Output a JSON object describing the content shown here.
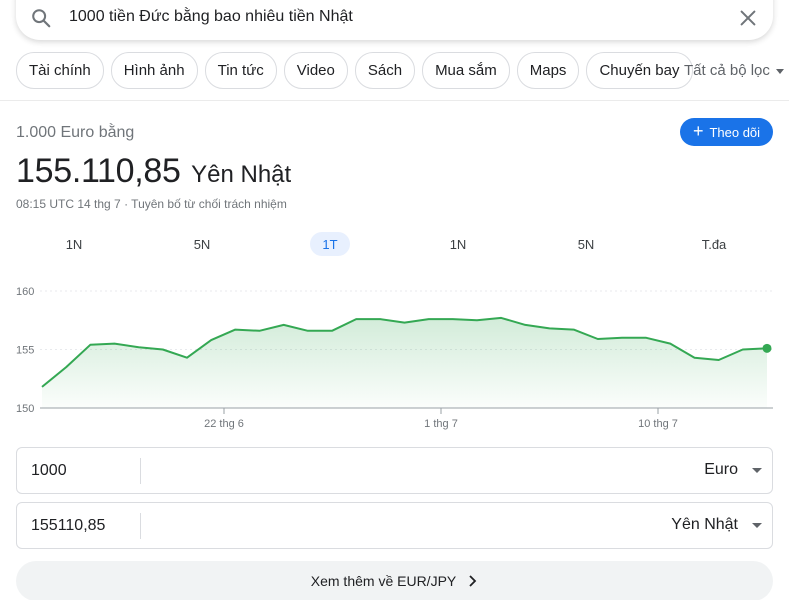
{
  "search": {
    "query": "1000 tiền Đức bằng bao nhiêu tiền Nhật"
  },
  "chips": [
    "Tài chính",
    "Hình ảnh",
    "Tin tức",
    "Video",
    "Sách",
    "Mua sắm",
    "Maps",
    "Chuyến bay"
  ],
  "filters_label": "Tất cả bộ lọc",
  "converter": {
    "from_text": "1.000 Euro bằng",
    "result_value": "155.110,85",
    "result_unit": "Yên Nhật",
    "timestamp": "08:15 UTC 14 thg 7 · Tuyên bố từ chối trách nhiệm",
    "follow_label": "Theo dõi",
    "amount_from": "1000",
    "currency_from": "Euro",
    "amount_to": "155110,85",
    "currency_to": "Yên Nhật",
    "more_label": "Xem thêm về EUR/JPY"
  },
  "ranges": [
    {
      "label": "1N",
      "active": false
    },
    {
      "label": "5N",
      "active": false
    },
    {
      "label": "1T",
      "active": true
    },
    {
      "label": "1N",
      "active": false
    },
    {
      "label": "5N",
      "active": false
    },
    {
      "label": "T.đa",
      "active": false
    }
  ],
  "colors": {
    "line": "#34a853",
    "accent": "#1a73e8"
  },
  "chart_data": {
    "type": "area",
    "yticks": [
      "160",
      "155",
      "150"
    ],
    "ylim": [
      150,
      160
    ],
    "xtick_labels": [
      "22 thg 6",
      "1 thg 7",
      "10 thg 7"
    ],
    "values": [
      151.8,
      153.5,
      155.4,
      155.5,
      155.2,
      155.0,
      154.3,
      155.8,
      156.7,
      156.6,
      157.1,
      156.6,
      156.6,
      157.6,
      157.6,
      157.3,
      157.6,
      157.6,
      157.5,
      157.7,
      157.1,
      156.8,
      156.7,
      155.9,
      156.0,
      156.0,
      155.5,
      154.3,
      154.1,
      155.0,
      155.1
    ]
  }
}
